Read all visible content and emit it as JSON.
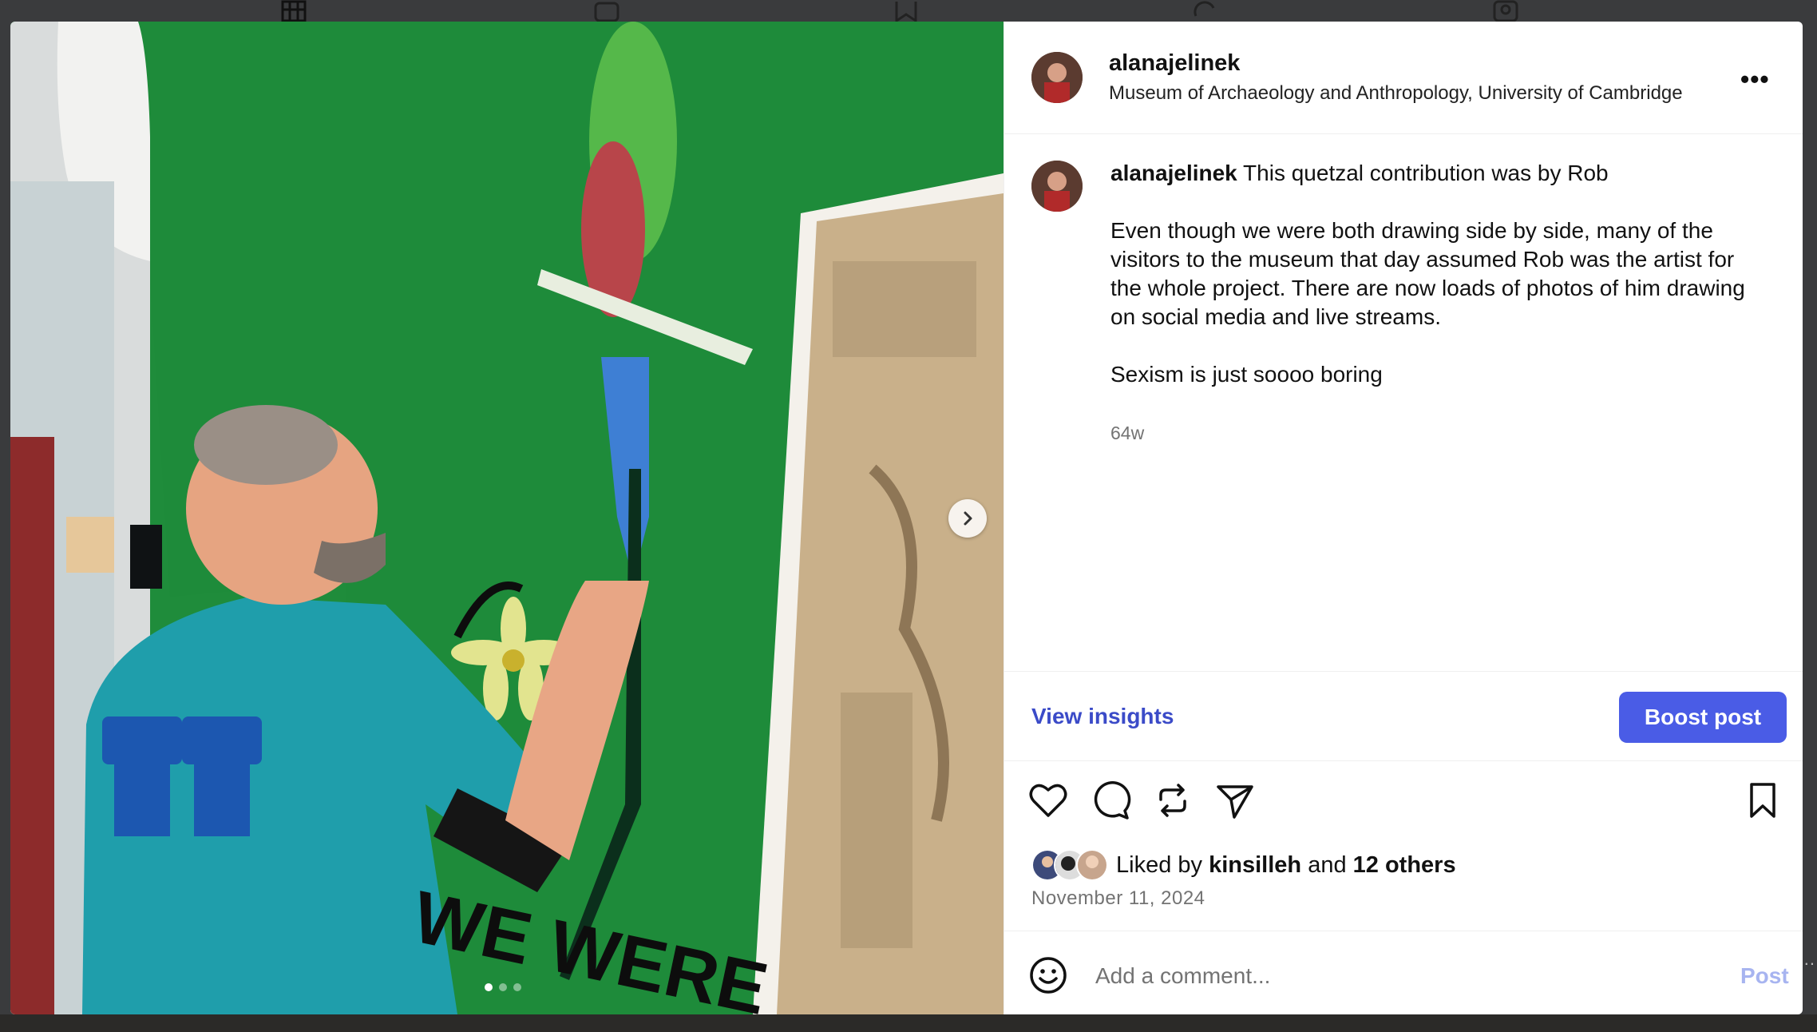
{
  "header": {
    "username": "alanajelinek",
    "location": "Museum of Archaeology and Anthropology, University of Cambridge",
    "more_icon": "more-horizontal-icon",
    "more_text": "•••"
  },
  "caption": {
    "username": "alanajelinek",
    "line1": "This quetzal contribution was by Rob",
    "para2": "Even though we were both drawing side by side, many of the visitors to the museum that day assumed Rob was the artist for the whole project. There are now loads of photos of him drawing on social media and live streams.",
    "para3": "Sexism is just soooo boring",
    "time_ago": "64w"
  },
  "insights": {
    "view_label": "View insights",
    "boost_label": "Boost post"
  },
  "actions": {
    "icons": [
      "heart-icon",
      "comment-icon",
      "repost-icon",
      "share-icon",
      "bookmark-icon"
    ]
  },
  "likes": {
    "prefix": "Liked by",
    "user": "kinsilleh",
    "joiner": "and",
    "others": "12 others"
  },
  "date": "November 11, 2024",
  "comment": {
    "placeholder": "Add a comment...",
    "post_label": "Post",
    "emoji_icon": "emoji-icon"
  },
  "media": {
    "carousel_total": 3,
    "carousel_active": 1,
    "next_icon": "chevron-right-icon"
  },
  "colors": {
    "accent": "#4a5ce6",
    "link": "#3b4bc8",
    "muted": "#737373"
  }
}
